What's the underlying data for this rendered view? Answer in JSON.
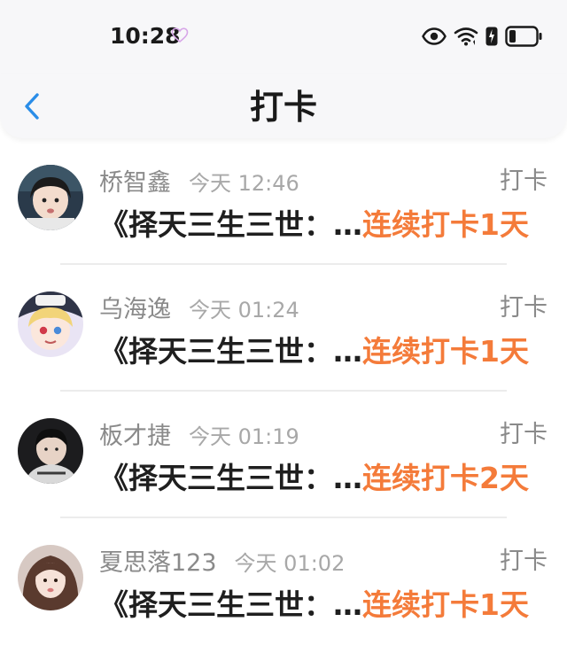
{
  "status_bar": {
    "time": "10:28",
    "icons": [
      "heart-icon",
      "eye-icon",
      "wifi-icon",
      "charging-icon",
      "battery-icon"
    ]
  },
  "nav": {
    "back_icon": "chevron-left-icon",
    "title": "打卡"
  },
  "colors": {
    "accent": "#f47b3a",
    "back": "#2a8de8",
    "meta": "#8a8a8a"
  },
  "feed": [
    {
      "name": "桥智鑫",
      "time": "今天 12:46",
      "action": "打卡",
      "title": "《择天三生三世：…",
      "streak": "连续打卡1天"
    },
    {
      "name": "乌海逸",
      "time": "今天 01:24",
      "action": "打卡",
      "title": "《择天三生三世：…",
      "streak": "连续打卡1天"
    },
    {
      "name": "板才捷",
      "time": "今天 01:19",
      "action": "打卡",
      "title": "《择天三生三世：…",
      "streak": "连续打卡2天"
    },
    {
      "name": "夏思落123",
      "time": "今天 01:02",
      "action": "打卡",
      "title": "《择天三生三世：…",
      "streak": "连续打卡1天"
    }
  ]
}
